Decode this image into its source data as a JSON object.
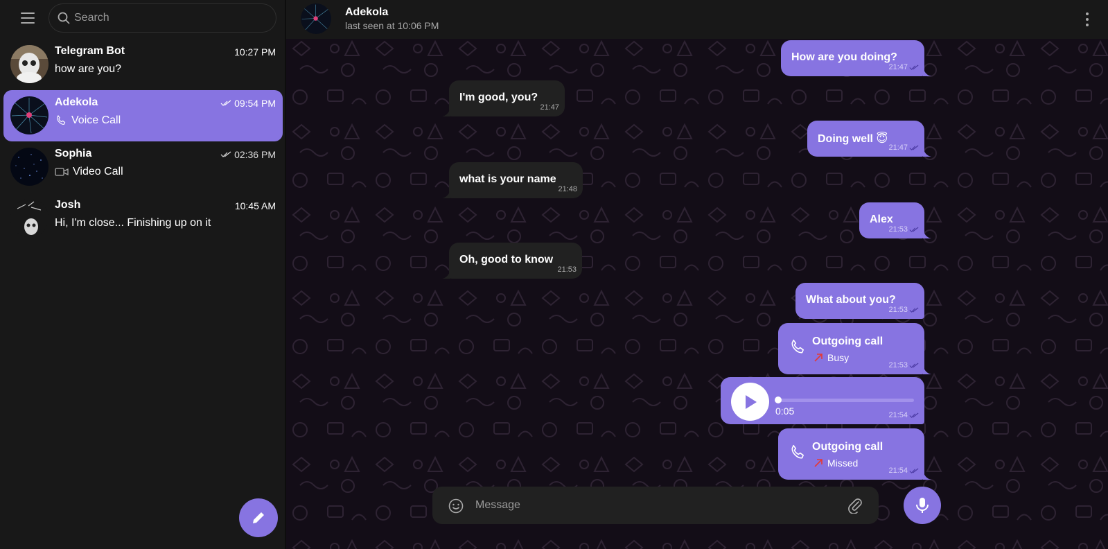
{
  "search": {
    "placeholder": "Search"
  },
  "chats": [
    {
      "name": "Telegram Bot",
      "time": "10:27 PM",
      "preview": "how are you?",
      "read": false,
      "preview_icon": "",
      "active": false
    },
    {
      "name": "Adekola",
      "time": "09:54 PM",
      "preview": "Voice Call",
      "read": true,
      "preview_icon": "phone-icon",
      "active": true
    },
    {
      "name": "Sophia",
      "time": "02:36 PM",
      "preview": "Video Call",
      "read": true,
      "preview_icon": "video-camera-icon",
      "active": false
    },
    {
      "name": "Josh",
      "time": "10:45 AM",
      "preview": "Hi, I'm close... Finishing up on it",
      "read": false,
      "preview_icon": "",
      "active": false
    }
  ],
  "header": {
    "name": "Adekola",
    "status": "last seen at 10:06 PM"
  },
  "messages": [
    {
      "dir": "out",
      "text": "How are you doing?",
      "time": "21:47"
    },
    {
      "dir": "in",
      "text": "I'm good, you?",
      "time": "21:47"
    },
    {
      "dir": "out",
      "text": "Doing well 😇",
      "time": "21:47"
    },
    {
      "dir": "in",
      "text": "what is your name",
      "time": "21:48"
    },
    {
      "dir": "out",
      "text": "Alex",
      "time": "21:53"
    },
    {
      "dir": "in",
      "text": "Oh, good to know",
      "time": "21:53"
    },
    {
      "dir": "out",
      "text": "What about you?",
      "time": "21:53"
    },
    {
      "dir": "out",
      "type": "call",
      "title": "Outgoing call",
      "status": "Busy",
      "time": "21:53"
    },
    {
      "dir": "out",
      "type": "voice",
      "duration": "0:05",
      "progress": 0.0,
      "time": "21:54"
    },
    {
      "dir": "out",
      "type": "call",
      "title": "Outgoing call",
      "status": "Missed",
      "time": "21:54"
    }
  ],
  "composer": {
    "placeholder": "Message"
  },
  "colors": {
    "accent": "#8774e1",
    "incoming_bubble": "#212121",
    "sidebar": "#181818",
    "call_arrow": "#e53935"
  },
  "icons": [
    "hamburger-menu-icon",
    "search-icon",
    "pencil-icon",
    "kebab-menu-icon",
    "double-check-icon",
    "phone-icon",
    "video-camera-icon",
    "play-icon",
    "smiley-icon",
    "paperclip-icon",
    "microphone-icon"
  ]
}
